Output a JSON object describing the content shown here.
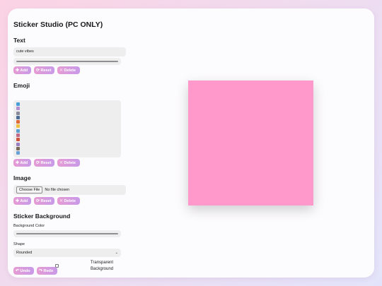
{
  "app": {
    "title": "Sticker Studio (PC ONLY)"
  },
  "text_section": {
    "title": "Text",
    "input_value": "cute vibes",
    "buttons": {
      "add": "Add",
      "reset": "Reset",
      "delete": "Delete"
    }
  },
  "emoji_section": {
    "title": "Emoji",
    "items": [
      "#4a9fd8",
      "#b58fcf",
      "#8a8a9a",
      "#4d6d96",
      "#e0693a",
      "#f0c040",
      "#5b9fd0",
      "#c06a8c",
      "#d2543e",
      "#9b7fc2",
      "#7a6a5a",
      "#6aa0d8"
    ],
    "buttons": {
      "add": "Add",
      "reset": "Reset",
      "delete": "Delete"
    }
  },
  "image_section": {
    "title": "Image",
    "choose_file": "Choose File",
    "file_status": "No file chosen",
    "buttons": {
      "add": "Add",
      "reset": "Reset",
      "delete": "Delete"
    }
  },
  "background_section": {
    "title": "Sticker Background",
    "color_label": "Background Color",
    "shape_label": "Shape",
    "shape_value": "Rounded",
    "transparent_label": "Transparent Background"
  },
  "history": {
    "undo": "Undo",
    "redo": "Redo"
  },
  "preview": {
    "color": "#ff99cc"
  },
  "colors": {
    "button_start": "#e69bd3",
    "button_end": "#c89ae8"
  }
}
